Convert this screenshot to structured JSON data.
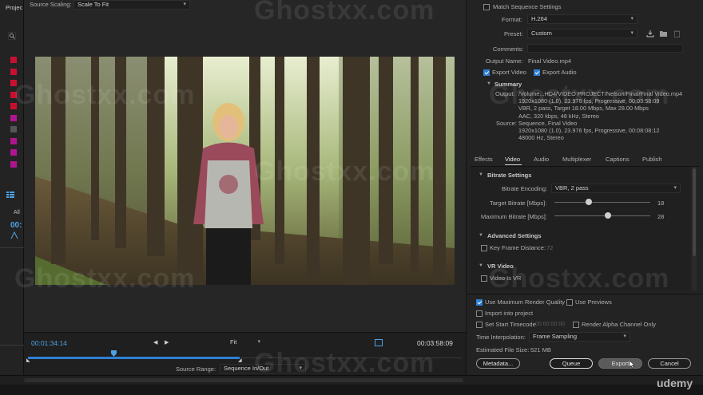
{
  "project_panel": {
    "title": "Projec",
    "all_label": "All",
    "timecode_frag": "00:",
    "swatch_colors": [
      "#c8102e",
      "#c8102e",
      "#c8102e",
      "#c8102e",
      "#c8102e",
      "#b0158f",
      "#555555",
      "#b0158f",
      "#b0158f",
      "#b0158f"
    ]
  },
  "source": {
    "scaling_label": "Source Scaling:",
    "scaling_value": "Scale To Fit",
    "current_time": "00:01:34:14",
    "duration": "00:03:58:09",
    "zoom_value": "Fit",
    "range_label": "Source Range:",
    "range_value": "Sequence In/Out",
    "playhead_fraction": 0.405
  },
  "export": {
    "match_sequence": "Match Sequence Settings",
    "format_label": "Format:",
    "format_value": "H.264",
    "preset_label": "Preset:",
    "preset_value": "Custom",
    "comments_label": "Comments:",
    "output_name_label": "Output Name:",
    "output_name_value": "Final Video.mp4",
    "export_video": "Export Video",
    "export_audio": "Export Audio",
    "summary_title": "Summary",
    "output_label": "Output:",
    "output_lines": [
      "/Volume...HD4/VIDEO PROJECT/Nelson/Final/Final Video.mp4",
      "1920x1080 (1.0), 23.976 fps, Progressive, 00:03:58:09",
      "VBR, 2 pass, Target 18.00 Mbps, Max 28.00 Mbps",
      "AAC, 320 kbps, 48 kHz, Stereo"
    ],
    "source_label": "Source:",
    "source_lines": [
      "Sequence, Final Video",
      "1920x1080 (1.0), 23.976 fps, Progressive, 00:08:08:12",
      "48000 Hz, Stereo"
    ]
  },
  "tabs": [
    "Effects",
    "Video",
    "Audio",
    "Multiplexer",
    "Captions",
    "Publish"
  ],
  "bitrate": {
    "title": "Bitrate Settings",
    "encoding_label": "Bitrate Encoding:",
    "encoding_value": "VBR, 2 pass",
    "target_label": "Target Bitrate [Mbps]:",
    "target_value": "18",
    "target_fraction": 0.36,
    "max_label": "Maximum Bitrate [Mbps]:",
    "max_value": "28",
    "max_fraction": 0.56
  },
  "advanced": {
    "title": "Advanced Settings",
    "keyframe_label": "Key Frame Distance:",
    "keyframe_value": "72"
  },
  "vr": {
    "title": "VR Video",
    "is_vr": "Video Is VR"
  },
  "bottom": {
    "max_render": "Use Maximum Render Quality",
    "use_previews": "Use Previews",
    "import_project": "Import into project",
    "set_start_tc": "Set Start Timecode",
    "start_tc_value": "00:00:00:00",
    "render_alpha": "Render Alpha Channel Only",
    "time_interp_label": "Time Interpolation:",
    "time_interp_value": "Frame Sampling",
    "file_size_label": "Estimated File Size:",
    "file_size_value": "521 MB",
    "metadata_btn": "Metadata...",
    "queue_btn": "Queue",
    "export_btn": "Export",
    "cancel_btn": "Cancel"
  },
  "watermark": "Ghostxx.com",
  "brand": "udemy"
}
